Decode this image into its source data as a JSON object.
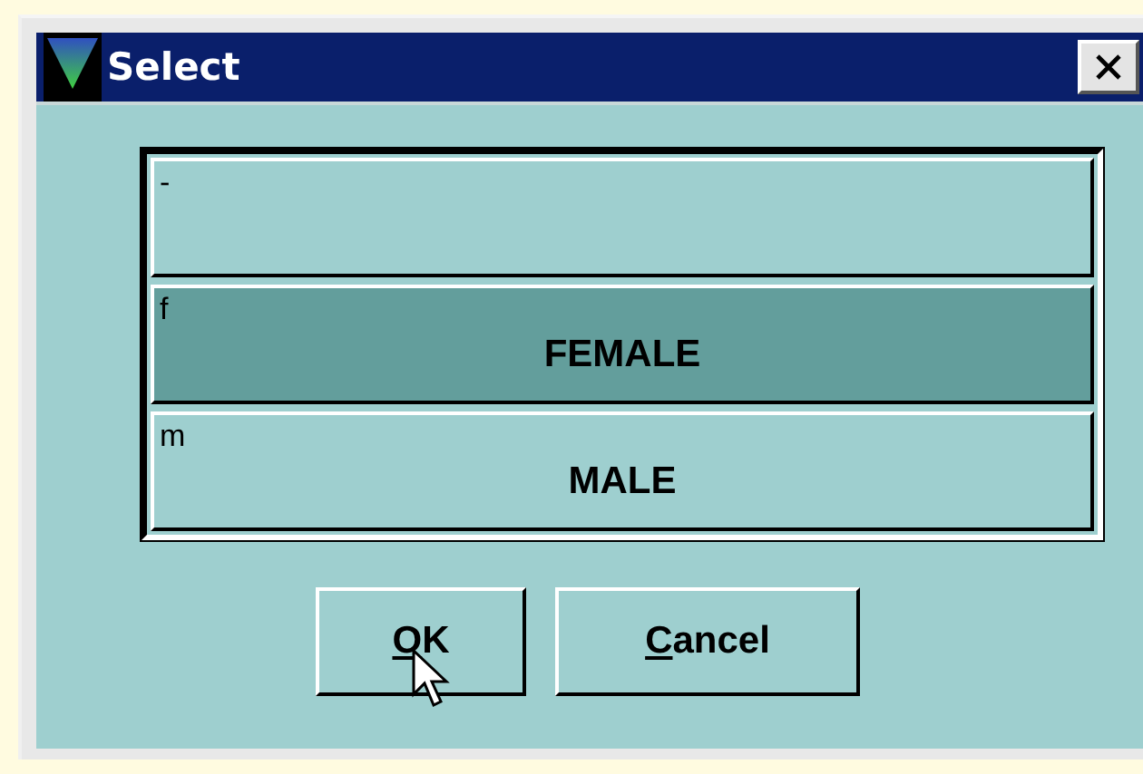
{
  "window": {
    "title": "Select"
  },
  "options": [
    {
      "code": "-",
      "selected": false
    },
    {
      "code": "f",
      "label": "FEMALE",
      "selected": true
    },
    {
      "code": "m",
      "label": "MALE",
      "selected": false
    }
  ],
  "buttons": [
    {
      "label": "OK"
    },
    {
      "label": "Cancel"
    }
  ]
}
